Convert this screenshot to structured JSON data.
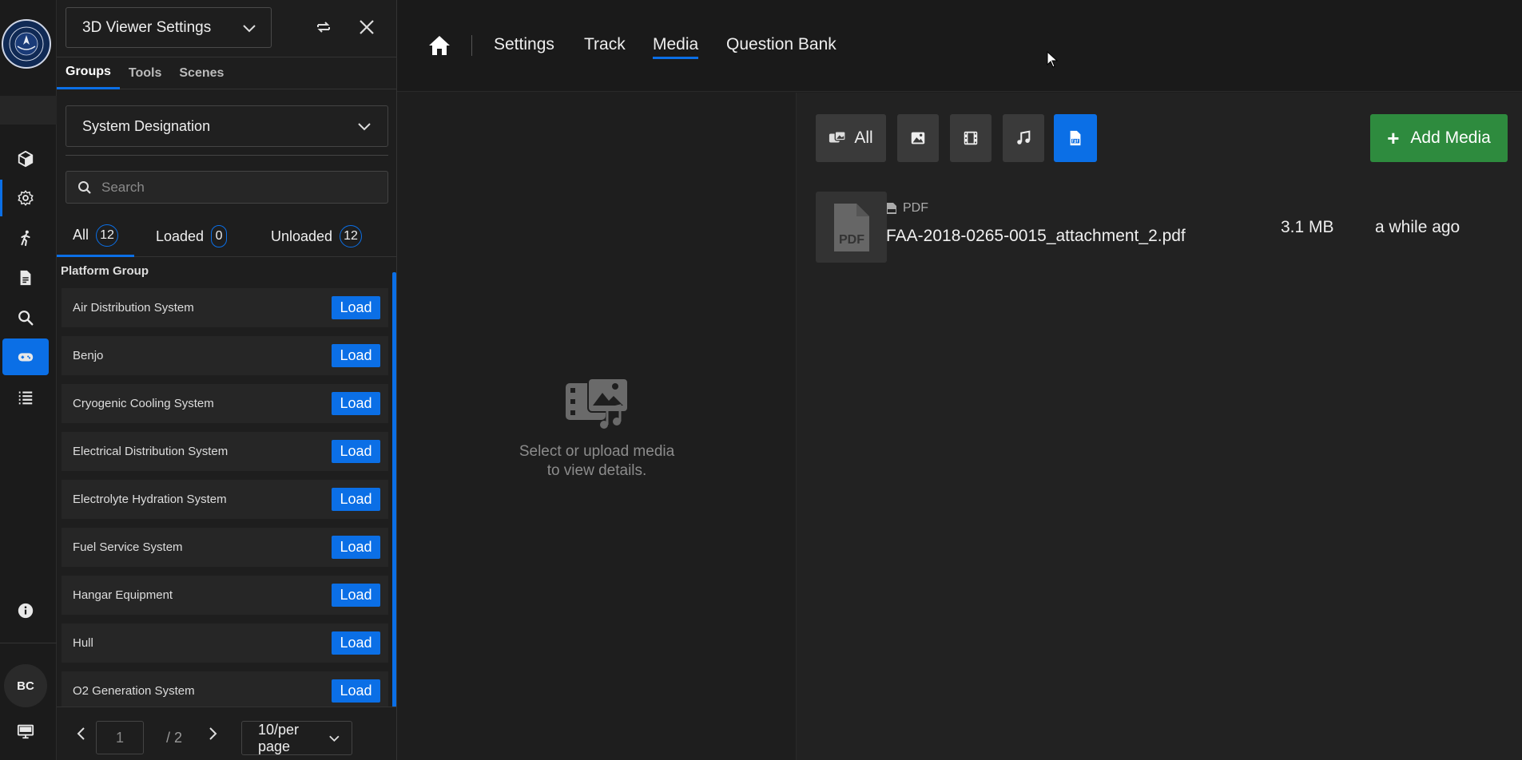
{
  "rail": {
    "avatar_initials": "BC",
    "items": [
      "cube-icon",
      "gear-icon",
      "walk-icon",
      "document-icon",
      "search-icon",
      "gamepad-icon",
      "list-icon",
      "info-icon",
      "monitor-icon"
    ],
    "accent": "#0b6fe6"
  },
  "panel": {
    "title": "3D Viewer Settings",
    "tabs": [
      "Groups",
      "Tools",
      "Scenes"
    ],
    "group_select": "System Designation",
    "search_placeholder": "Search",
    "filters": [
      {
        "label": "All",
        "count": "12"
      },
      {
        "label": "Loaded",
        "count": "0"
      },
      {
        "label": "Unloaded",
        "count": "12"
      }
    ],
    "group_label": "Platform Group",
    "load_label": "Load",
    "items": [
      "Air Distribution System",
      "Benjo",
      "Cryogenic Cooling System",
      "Electrical Distribution System",
      "Electrolyte Hydration System",
      "Fuel Service System",
      "Hangar Equipment",
      "Hull",
      "O2 Generation System"
    ],
    "pager": {
      "page": "1",
      "total": "/ 2",
      "per_page": "10/per page"
    }
  },
  "nav": {
    "links": [
      "Settings",
      "Track",
      "Media",
      "Question Bank"
    ],
    "active": "Media"
  },
  "detail": {
    "empty_line1": "Select or upload media",
    "empty_line2": "to view details."
  },
  "media": {
    "filter_all": "All",
    "add_label": "Add Media",
    "add_color": "#2e8b3e",
    "files": [
      {
        "type": "PDF",
        "name": "FAA-2018-0265-0015_attachment_2.pdf",
        "size": "3.1 MB",
        "time": "a while ago"
      }
    ]
  }
}
